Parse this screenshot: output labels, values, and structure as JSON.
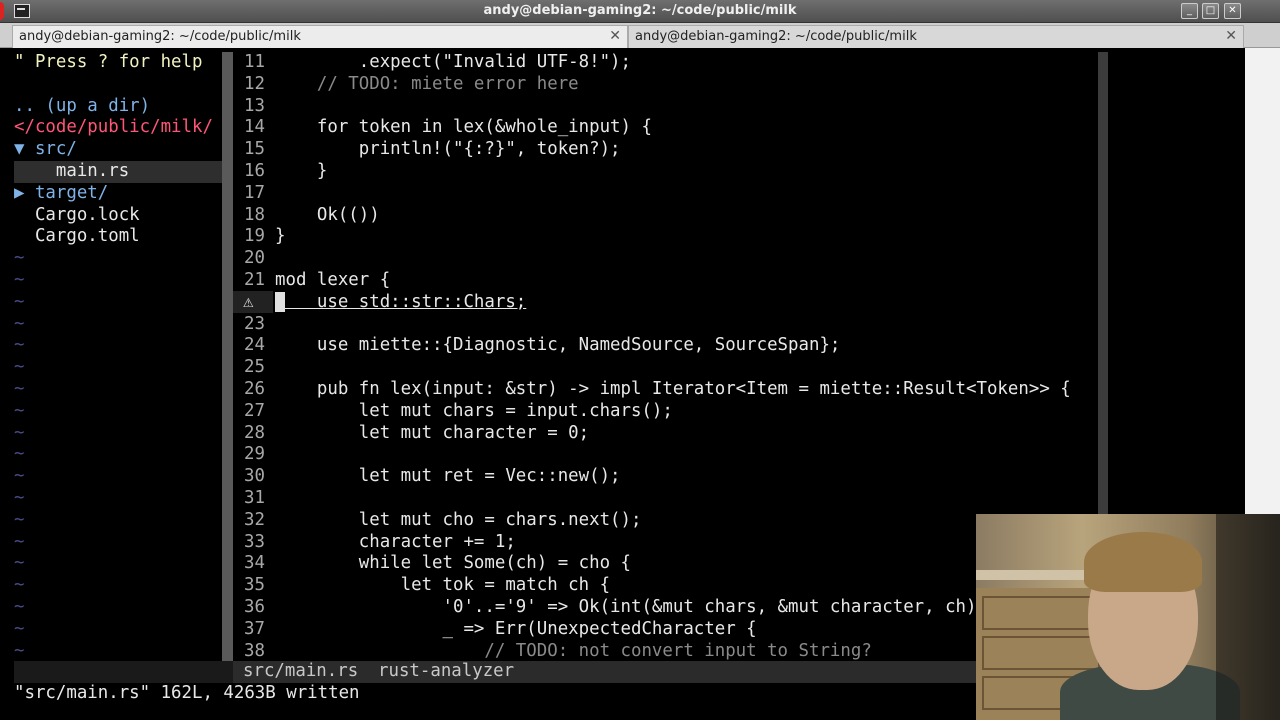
{
  "window": {
    "title": "andy@debian-gaming2: ~/code/public/milk",
    "minimize_glyph": "_",
    "maximize_glyph": "□",
    "close_glyph": "✕"
  },
  "tabs": [
    {
      "label": "andy@debian-gaming2: ~/code/public/milk",
      "close": "✕"
    },
    {
      "label": "andy@debian-gaming2: ~/code/public/milk",
      "close": "✕"
    }
  ],
  "tree": {
    "lines": [
      "\" Press ? for help",
      "",
      ".. (up a dir)",
      "</code/public/milk/",
      "▼ src/",
      "    main.rs",
      "▶ target/",
      "  Cargo.lock",
      "  Cargo.toml",
      "~",
      "~",
      "~",
      "~",
      "~",
      "~",
      "~",
      "~",
      "~",
      "~",
      "~",
      "~",
      "~",
      "~",
      "~",
      "~",
      "~",
      "~",
      "~"
    ]
  },
  "editor": {
    "line_numbers": [
      "11",
      "12",
      "13",
      "14",
      "15",
      "16",
      "17",
      "18",
      "19",
      "20",
      "21",
      "",
      "23",
      "24",
      "25",
      "26",
      "27",
      "28",
      "29",
      "30",
      "31",
      "32",
      "33",
      "34",
      "35",
      "36",
      "37",
      "38"
    ],
    "warning_sign": "⚠",
    "lines": [
      "        .expect(\"Invalid UTF-8!\");",
      "    // TODO: miete error here",
      "",
      "    for token in lex(&whole_input) {",
      "        println!(\"{:?}\", token?);",
      "    }",
      "",
      "    Ok(())",
      "}",
      "",
      "mod lexer {",
      "    use std::str::Chars;",
      "",
      "    use miette::{Diagnostic, NamedSource, SourceSpan};",
      "",
      "    pub fn lex(input: &str) -> impl Iterator<Item = miette::Result<Token>> {",
      "        let mut chars = input.chars();",
      "        let mut character = 0;",
      "",
      "        let mut ret = Vec::new();",
      "",
      "        let mut cho = chars.next();",
      "        character += 1;",
      "        while let Some(ch) = cho {",
      "            let tok = match ch {",
      "                '0'..='9' => Ok(int(&mut chars, &mut character, ch)",
      "                _ => Err(UnexpectedCharacter {",
      "                    // TODO: not convert input to String?"
    ]
  },
  "statusline": {
    "file": "src/main.rs",
    "lsp": "rust-analyzer"
  },
  "cmdline": "\"src/main.rs\" 162L, 4263B written"
}
